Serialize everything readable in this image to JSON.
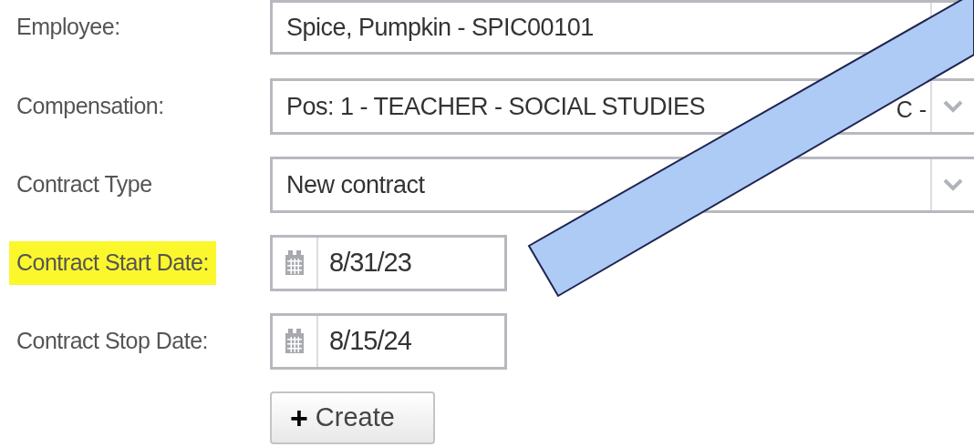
{
  "fields": [
    {
      "kind": "select",
      "label": "Employee:",
      "value": "Spice, Pumpkin - SPIC00101",
      "highlighted": false
    },
    {
      "kind": "select",
      "label": "Compensation:",
      "value": "Pos: 1 - TEACHER - SOCIAL STUDIES",
      "tail": "C -",
      "highlighted": false
    },
    {
      "kind": "select",
      "label": "Contract Type",
      "value": "New contract",
      "highlighted": false
    },
    {
      "kind": "date",
      "label": "Contract Start Date:",
      "value": "8/31/23",
      "highlighted": true
    },
    {
      "kind": "date",
      "label": "Contract Stop Date:",
      "value": "8/15/24",
      "highlighted": false
    }
  ],
  "create_button": {
    "label": "Create",
    "icon": "+"
  }
}
